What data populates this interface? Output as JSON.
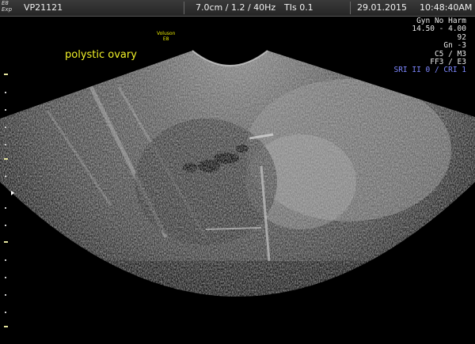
{
  "header": {
    "exp_logo_line1": "E8",
    "exp_logo_line2": "Exp",
    "patient_id": "VP21121",
    "depth_freq": "7.0cm / 1.2 / 40Hz",
    "tis": "TIs  0.1",
    "date": "29.01.2015",
    "time": "10:48:40AM"
  },
  "probe_logo": {
    "brand": "Voluson",
    "model": "E8"
  },
  "annotation": "polystic ovary",
  "params": {
    "mode": "Gyn No Harm",
    "freq_range": "14.50 - 4.00",
    "value_92": "92",
    "gain": "Gn  -3",
    "map": "C5 / M3",
    "ff": "FF3 / E3",
    "sri": "SRI II 0 / CRI 1"
  },
  "colors": {
    "background": "#000000",
    "annotation": "#f2f228",
    "sri_text": "#7d87ff",
    "header_bg": "#2e2e2e"
  },
  "icons": {
    "depth_marker": "triangle-right-icon"
  }
}
